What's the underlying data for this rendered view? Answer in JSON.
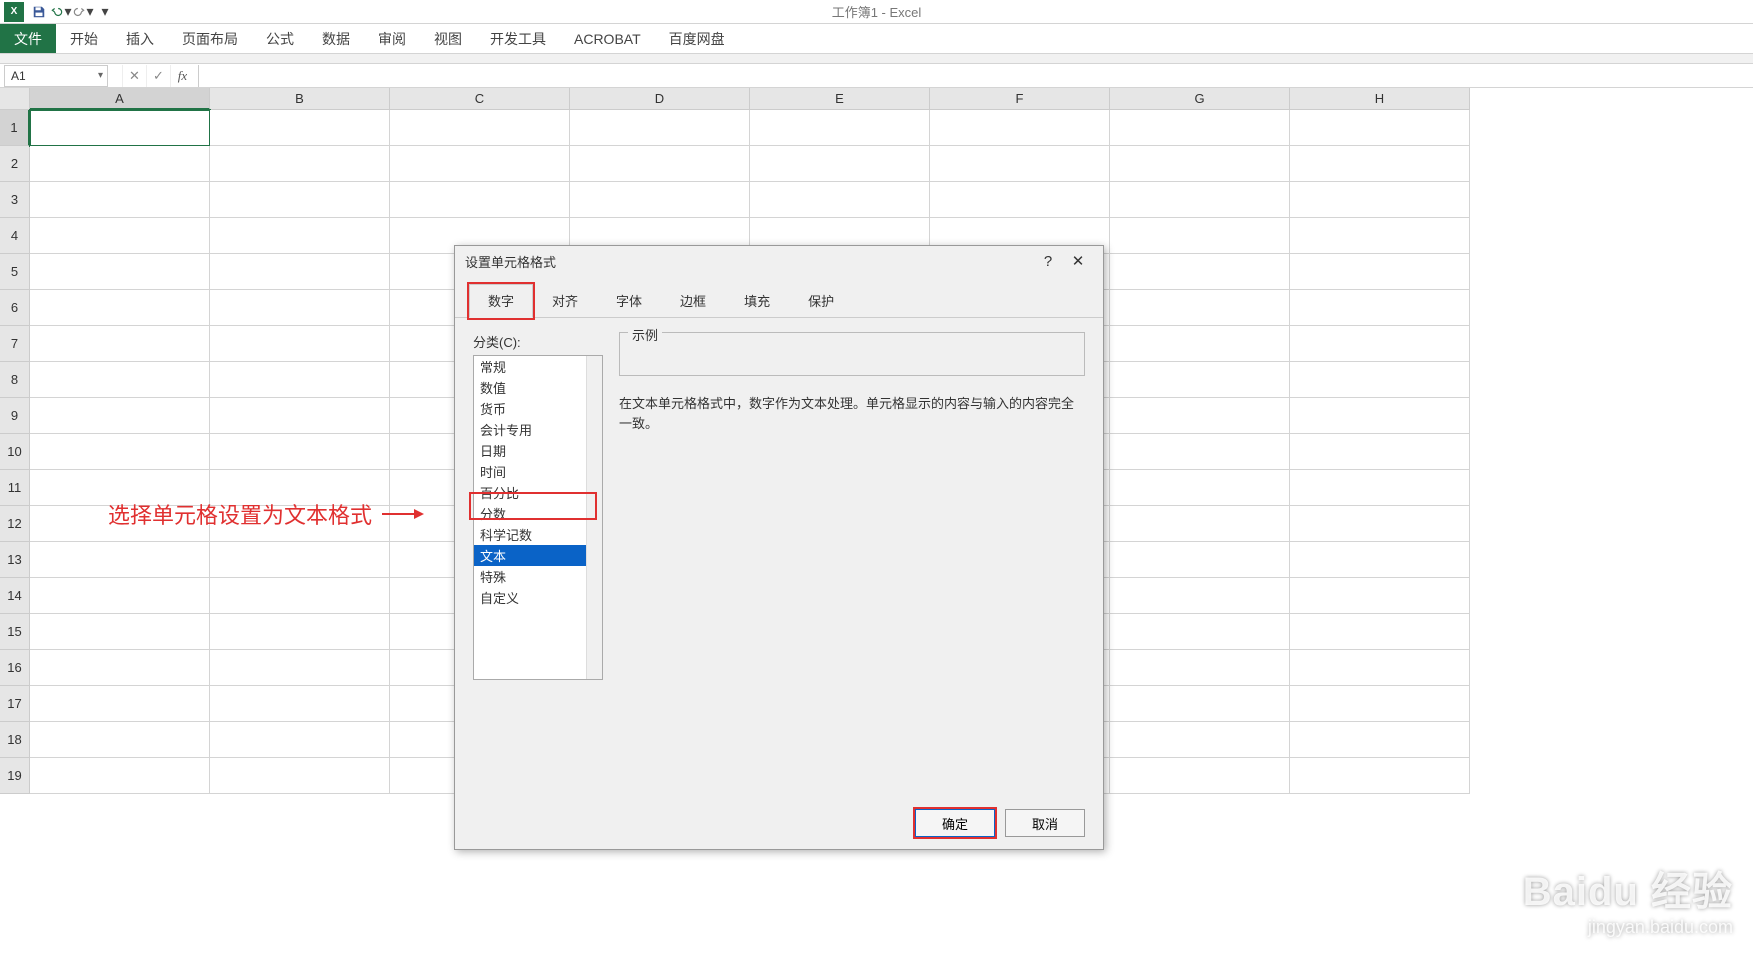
{
  "titlebar": {
    "doc_title": "工作簿1 - Excel"
  },
  "ribbon": {
    "tabs": [
      "文件",
      "开始",
      "插入",
      "页面布局",
      "公式",
      "数据",
      "审阅",
      "视图",
      "开发工具",
      "ACROBAT",
      "百度网盘"
    ]
  },
  "namebox": {
    "value": "A1"
  },
  "columns": [
    "A",
    "B",
    "C",
    "D",
    "E",
    "F",
    "G",
    "H"
  ],
  "rows": [
    "1",
    "2",
    "3",
    "4",
    "5",
    "6",
    "7",
    "8",
    "9",
    "10",
    "11",
    "12",
    "13",
    "14",
    "15",
    "16",
    "17",
    "18",
    "19"
  ],
  "annotation": {
    "text": "选择单元格设置为文本格式"
  },
  "dialog": {
    "title": "设置单元格格式",
    "tabs": [
      "数字",
      "对齐",
      "字体",
      "边框",
      "填充",
      "保护"
    ],
    "category_label": "分类(C):",
    "categories": [
      "常规",
      "数值",
      "货币",
      "会计专用",
      "日期",
      "时间",
      "百分比",
      "分数",
      "科学记数",
      "文本",
      "特殊",
      "自定义"
    ],
    "selected_category": "文本",
    "sample_label": "示例",
    "description": "在文本单元格格式中，数字作为文本处理。单元格显示的内容与输入的内容完全一致。",
    "ok": "确定",
    "cancel": "取消"
  },
  "watermark": {
    "brand": "Baidu",
    "suffix": "经验",
    "url": "jingyan.baidu.com"
  }
}
